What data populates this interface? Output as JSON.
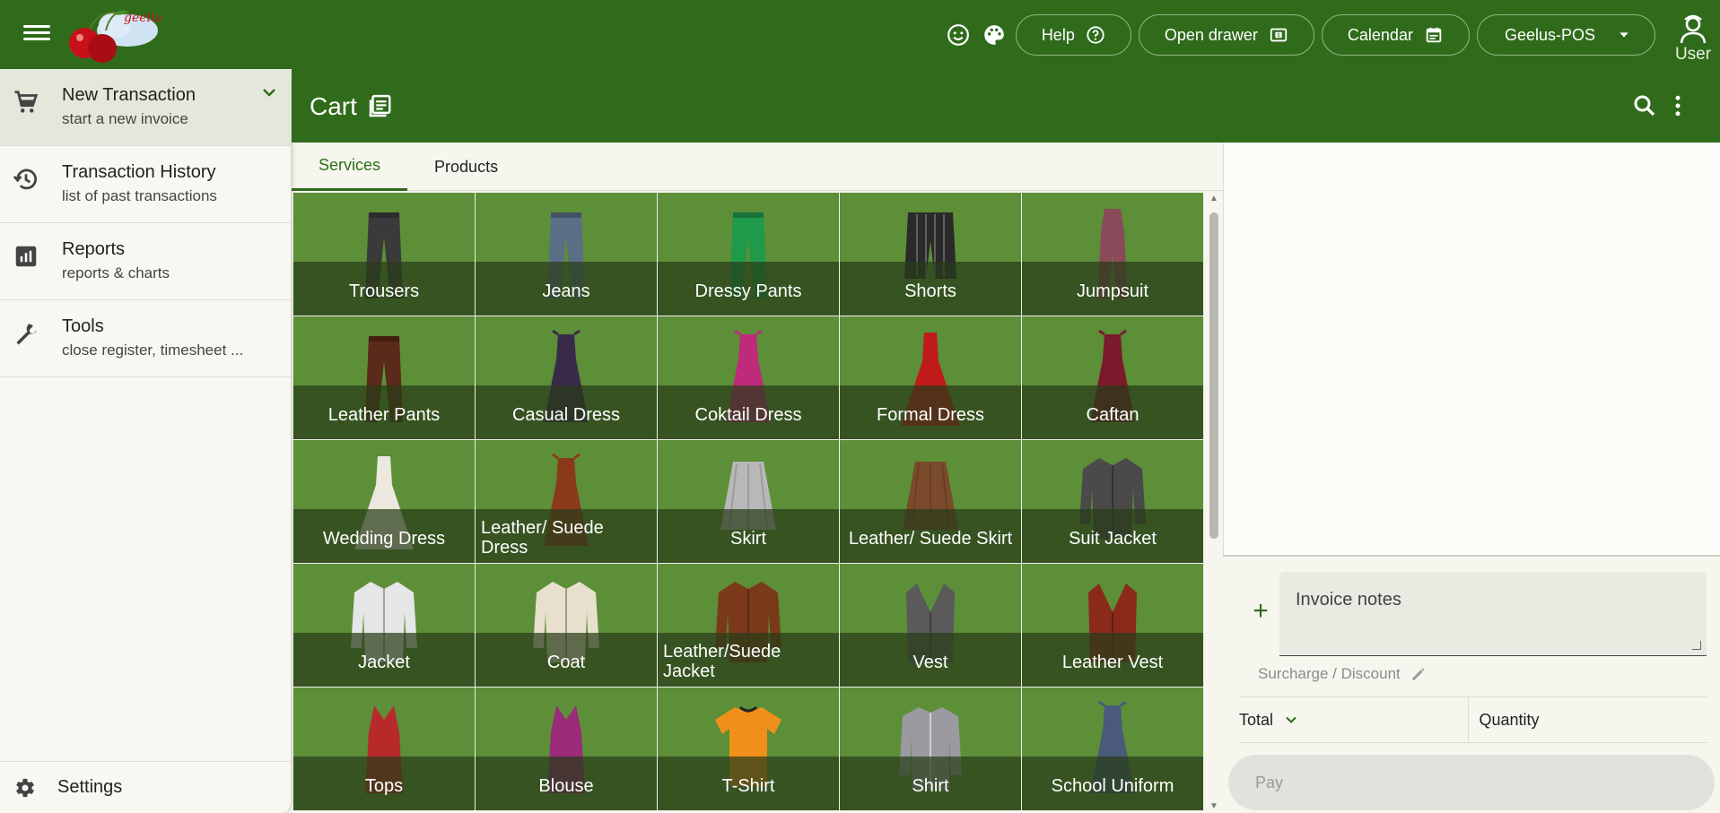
{
  "header": {
    "help_label": "Help",
    "drawer_label": "Open drawer",
    "calendar_label": "Calendar",
    "store_label": "Geelus-POS",
    "user_label": "User",
    "logo_text": "geelus"
  },
  "sidebar": {
    "items": [
      {
        "title": "New Transaction",
        "subtitle": "start a new invoice"
      },
      {
        "title": "Transaction History",
        "subtitle": "list of past transactions"
      },
      {
        "title": "Reports",
        "subtitle": "reports & charts"
      },
      {
        "title": "Tools",
        "subtitle": "close register, timesheet ..."
      }
    ],
    "settings_label": "Settings"
  },
  "cart": {
    "title": "Cart"
  },
  "tabs": [
    {
      "label": "Services"
    },
    {
      "label": "Products"
    }
  ],
  "tiles": [
    {
      "label": "Trousers",
      "color": "#3a3a3a",
      "shape": "pants"
    },
    {
      "label": "Jeans",
      "color": "#5a6f86",
      "shape": "pants"
    },
    {
      "label": "Dressy Pants",
      "color": "#1f9a4a",
      "shape": "pants"
    },
    {
      "label": "Shorts",
      "color": "#2a2a2a",
      "shape": "shorts"
    },
    {
      "label": "Jumpsuit",
      "color": "#8a4a5a",
      "shape": "jumpsuit"
    },
    {
      "label": "Leather Pants",
      "color": "#5a2a1a",
      "shape": "pants"
    },
    {
      "label": "Casual Dress",
      "color": "#3a2a4a",
      "shape": "dress"
    },
    {
      "label": "Coktail Dress",
      "color": "#c02a7a",
      "shape": "dress"
    },
    {
      "label": "Formal Dress",
      "color": "#c01a1a",
      "shape": "gown"
    },
    {
      "label": "Caftan",
      "color": "#7a1a2a",
      "shape": "dress"
    },
    {
      "label": "Wedding Dress",
      "color": "#ece8de",
      "shape": "gown"
    },
    {
      "label": "Leather/ Suede Dress",
      "color": "#8a3a1a",
      "shape": "dress"
    },
    {
      "label": "Skirt",
      "color": "#b8b8b8",
      "shape": "skirt"
    },
    {
      "label": "Leather/ Suede Skirt",
      "color": "#7a4a2a",
      "shape": "skirt"
    },
    {
      "label": "Suit Jacket",
      "color": "#4a4a4a",
      "shape": "jacket"
    },
    {
      "label": "Jacket",
      "color": "#e6e6e6",
      "shape": "jacket"
    },
    {
      "label": "Coat",
      "color": "#e8e0cc",
      "shape": "jacket"
    },
    {
      "label": "Leather/Suede Jacket",
      "color": "#7a3a1a",
      "shape": "jacket"
    },
    {
      "label": "Vest",
      "color": "#5a5a5a",
      "shape": "vest"
    },
    {
      "label": "Leather Vest",
      "color": "#8a2a1a",
      "shape": "vest"
    },
    {
      "label": "Tops",
      "color": "#b82a2a",
      "shape": "top"
    },
    {
      "label": "Blouse",
      "color": "#9a2a7a",
      "shape": "top"
    },
    {
      "label": "T-Shirt",
      "color": "#f0901a",
      "shape": "tshirt"
    },
    {
      "label": "Shirt",
      "color": "#9a9aa0",
      "shape": "shirt"
    },
    {
      "label": "School Uniform",
      "color": "#4a5a7a",
      "shape": "dress"
    }
  ],
  "panel": {
    "notes_placeholder": "Invoice notes",
    "surcharge_label": "Surcharge / Discount",
    "total_label": "Total",
    "quantity_label": "Quantity",
    "pay_label": "Pay"
  },
  "colors": {
    "brand": "#2f6b1b",
    "tile_bg": "#5c8f38"
  }
}
